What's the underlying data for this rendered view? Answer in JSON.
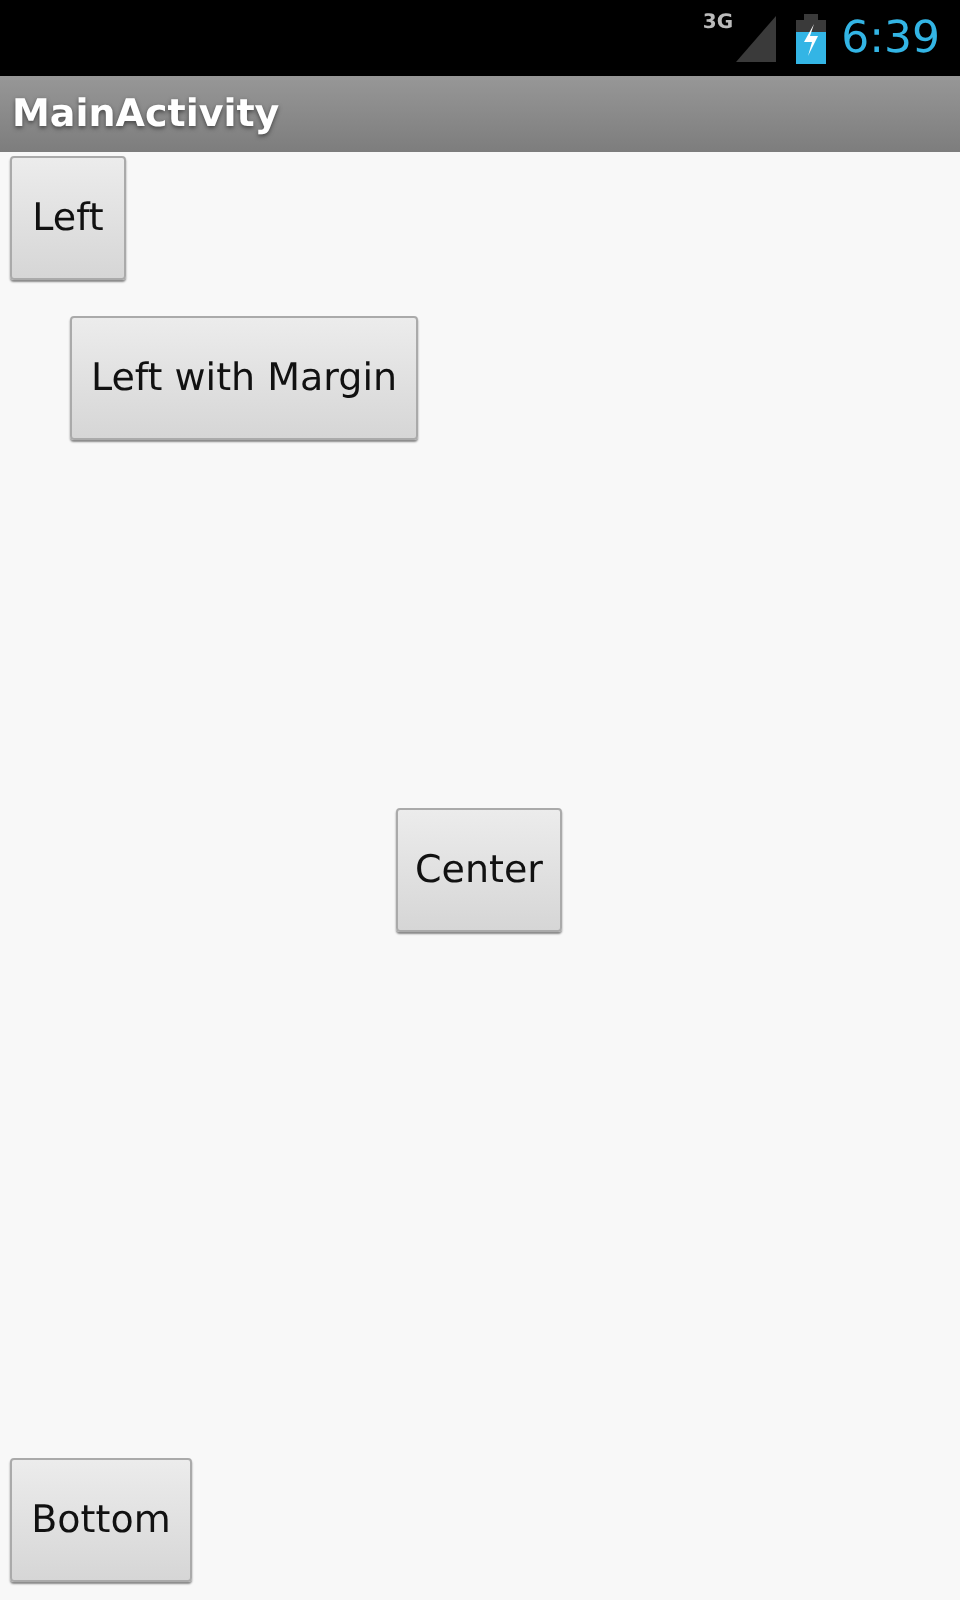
{
  "status_bar": {
    "network": "3G",
    "time": "6:39"
  },
  "title_bar": {
    "title": "MainActivity"
  },
  "buttons": [
    {
      "label": "Left",
      "kind": "left"
    },
    {
      "label": "Left with Margin",
      "kind": "margin"
    },
    {
      "label": "Center",
      "kind": "center"
    },
    {
      "label": "Bottom",
      "kind": "bottom"
    }
  ]
}
